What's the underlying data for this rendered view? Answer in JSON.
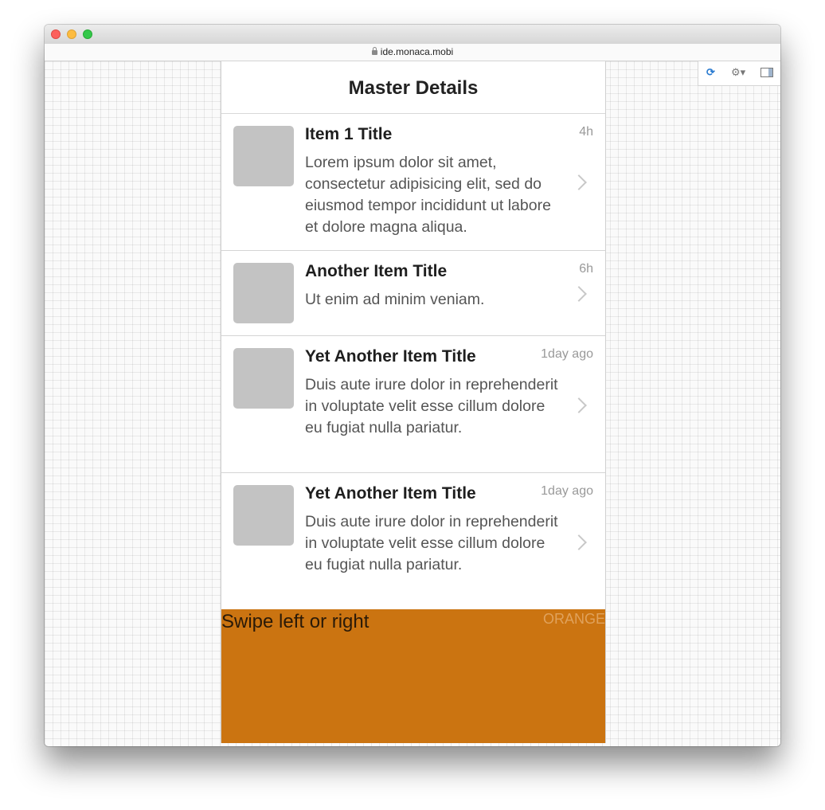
{
  "browser": {
    "url": "ide.monaca.mobi"
  },
  "toolbar": {
    "refresh_icon": "refresh-icon",
    "settings_icon": "gear-icon",
    "panel_icon": "panel-icon"
  },
  "app": {
    "title": "Master Details",
    "items": [
      {
        "title": "Item 1 Title",
        "description": "Lorem ipsum dolor sit amet, consectetur adipisicing elit, sed do eiusmod tempor incididunt ut labore et dolore magna aliqua.",
        "time": "4h"
      },
      {
        "title": "Another Item Title",
        "description": "Ut enim ad minim veniam.",
        "time": "6h"
      },
      {
        "title": "Yet Another Item Title",
        "description": "Duis aute irure dolor in reprehenderit in voluptate velit esse cillum dolore eu fugiat nulla pariatur.",
        "time": "1day ago"
      },
      {
        "title": "Yet Another Item Title",
        "description": "Duis aute irure dolor in reprehenderit in voluptate velit esse cillum dolore eu fugiat nulla pariatur.",
        "time": "1day ago"
      }
    ],
    "carousel": {
      "instruction": "Swipe left or right",
      "label": "ORANGE",
      "color": "#cb7411"
    }
  }
}
